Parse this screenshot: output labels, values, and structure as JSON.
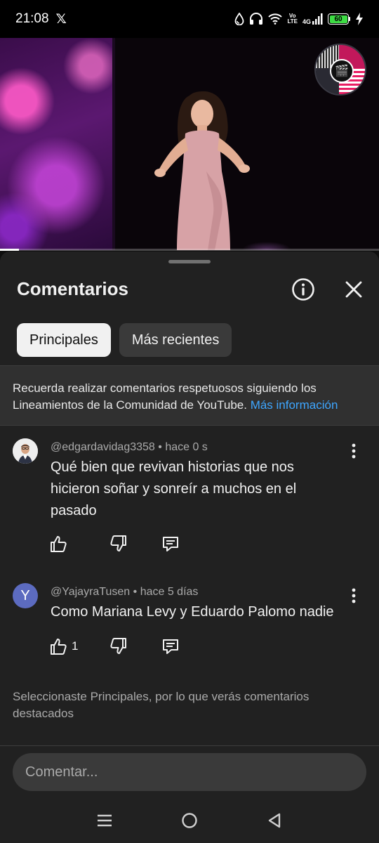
{
  "status_bar": {
    "time": "21:08",
    "app_icon": "x-logo",
    "network_label": "4G",
    "volte_label_top": "Vo",
    "volte_label_bottom": "LTE",
    "battery": "60",
    "icons": [
      "water-drop-icon",
      "headphones-icon",
      "wifi-icon",
      "signal-icon",
      "battery-icon",
      "charging-icon"
    ]
  },
  "video": {
    "progress_fraction": 0.05,
    "channel_logo_icon": "channel-logo"
  },
  "comments_panel": {
    "title": "Comentarios",
    "info_icon": "info-icon",
    "close_icon": "close-icon",
    "tabs": [
      {
        "label": "Principales",
        "active": true
      },
      {
        "label": "Más recientes",
        "active": false
      }
    ],
    "notice": {
      "text": "Recuerda realizar comentarios respetuosos siguiendo los Lineamientos de la Comunidad de YouTube.",
      "link": "Más información"
    },
    "comments": [
      {
        "author": "@edgardavidag3358",
        "time": "hace 0 s",
        "text": "Qué bien que revivan historias que nos hicieron soñar y sonreír a muchos en el pasado",
        "likes": "",
        "avatar": "photo"
      },
      {
        "author": "@YajayraTusen",
        "time": "hace 5 días",
        "text": "Como Mariana Levy y Eduardo Palomo nadie",
        "likes": "1",
        "avatar": "Y"
      }
    ],
    "footer_note": "Seleccionaste Principales, por lo que verás comentarios destacados",
    "comment_input": {
      "placeholder": "Comentar..."
    }
  },
  "colors": {
    "background": "#0f0f0f",
    "panel": "#212121",
    "link": "#3ea6ff",
    "avatar_y": "#5c6bc0",
    "battery": "#3ddc44"
  },
  "nav_bar": {
    "icons": [
      "menu-icon",
      "home-icon",
      "back-icon"
    ]
  }
}
